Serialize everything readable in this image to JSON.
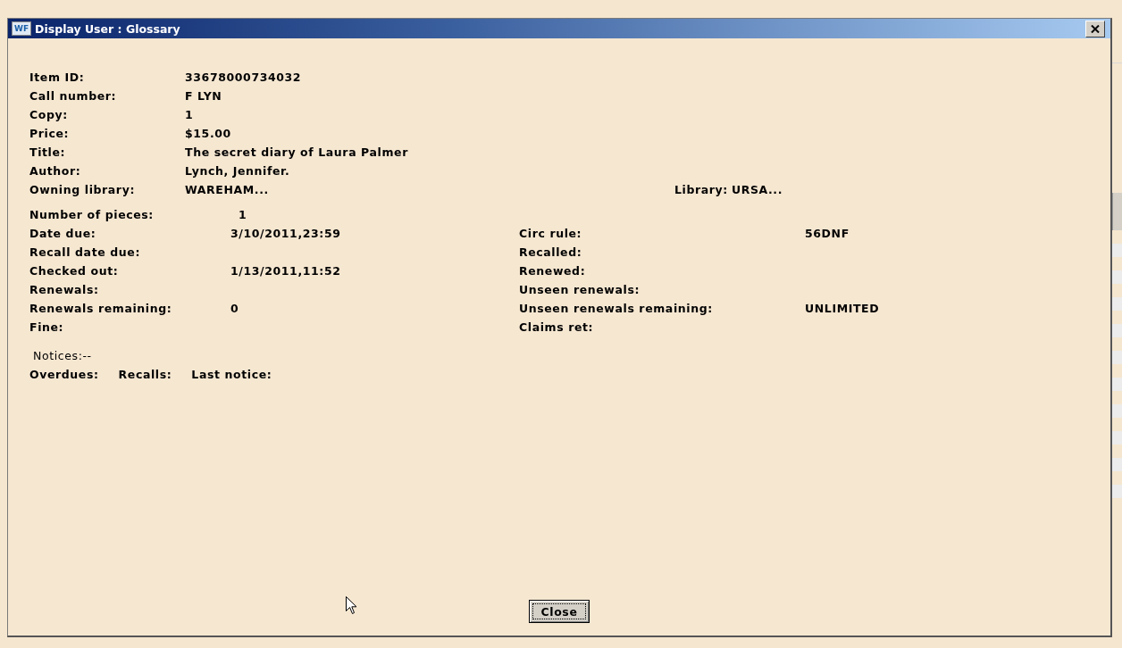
{
  "window": {
    "icon_text": "WF",
    "title": "Display User : Glossary"
  },
  "item_fields": [
    {
      "label": "Item ID:",
      "value": "33678000734032"
    },
    {
      "label": "Call number:",
      "value": "F LYN"
    },
    {
      "label": "Copy:",
      "value": "1"
    },
    {
      "label": "Price:",
      "value": "$15.00"
    },
    {
      "label": "Title:",
      "value": "The secret diary of Laura Palmer"
    },
    {
      "label": "Author:",
      "value": "Lynch, Jennifer."
    }
  ],
  "owning_library": {
    "label": "Owning library:",
    "value": "WAREHAM..."
  },
  "library": {
    "label": "Library:",
    "value": "URSA..."
  },
  "circulation_left": [
    {
      "label": "Number of pieces:",
      "value": "1"
    },
    {
      "label": "Date due:",
      "value": "3/10/2011,23:59"
    },
    {
      "label": "Recall date due:"
    },
    {
      "label": "Checked out:",
      "value": "1/13/2011,11:52"
    },
    {
      "label": "Renewals:"
    },
    {
      "label": "Renewals remaining:",
      "value": "0"
    },
    {
      "label": "Fine:"
    }
  ],
  "circulation_right": [
    {
      "label": "Circ rule:",
      "value": "56DNF"
    },
    {
      "label": "Recalled:"
    },
    {
      "label": "Renewed:"
    },
    {
      "label": "Unseen renewals:"
    },
    {
      "label": "Unseen renewals remaining:",
      "value": "UNLIMITED"
    },
    {
      "label": "Claims ret:"
    }
  ],
  "notices": {
    "heading": "Notices:--",
    "fields": [
      "Overdues:",
      "Recalls:",
      "Last notice:"
    ]
  },
  "buttons": [
    "Close"
  ]
}
